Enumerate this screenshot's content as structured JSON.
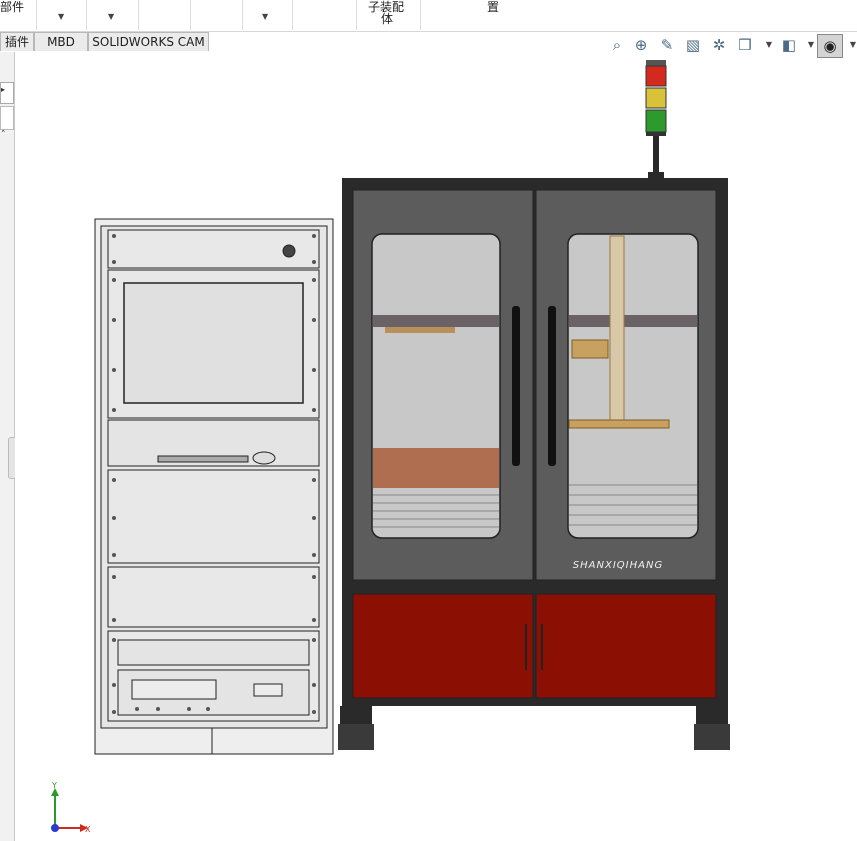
{
  "ribbon": {
    "cut_label_1": "部件",
    "assembly_label_line1": "子装配",
    "assembly_label_line2": "体",
    "cut_label_2": "置"
  },
  "tabs": [
    {
      "label": "插件"
    },
    {
      "label": "MBD"
    },
    {
      "label": "SOLIDWORKS CAM"
    }
  ],
  "hud_icons": [
    "zoom-to-fit-icon",
    "zoom-area-icon",
    "previous-view-icon",
    "section-view-icon",
    "dynamic-annotation-icon",
    "view-orientation-icon",
    "display-style-icon",
    "hide-show-icon"
  ],
  "model": {
    "brand_text": "SHANXIQIHANG"
  },
  "triad": {
    "x_label": "X",
    "y_label": "Y"
  },
  "colors": {
    "cabinet_red": "#8b0f02",
    "door_glass": "#5c5c5c",
    "frame_dark": "#2a2a2a",
    "light_red": "#d42a1e",
    "light_yellow": "#d8c23a",
    "light_green": "#2e9a2e"
  }
}
